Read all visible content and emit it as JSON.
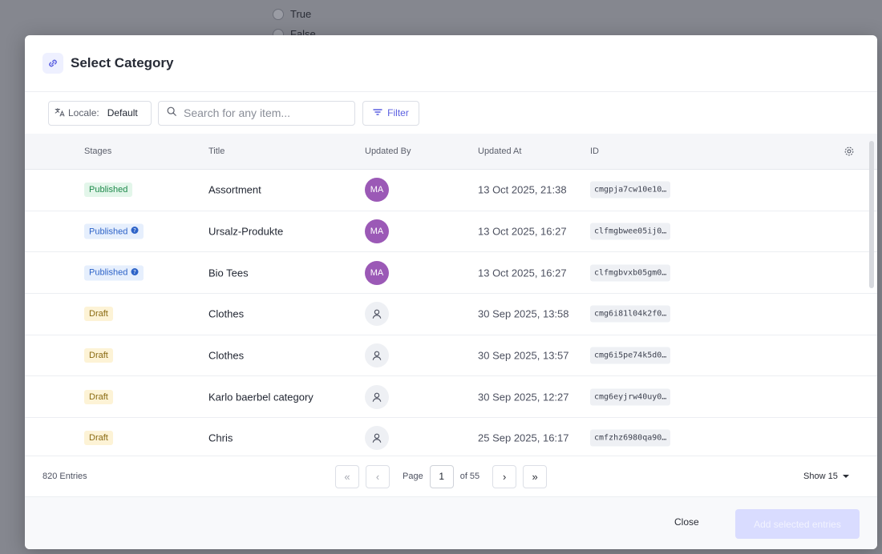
{
  "background": {
    "radios": [
      {
        "label": "True"
      },
      {
        "label": "False"
      }
    ]
  },
  "modal": {
    "title": "Select Category",
    "locale": {
      "label": "Locale:",
      "value": "Default"
    },
    "search": {
      "placeholder": "Search for any item..."
    },
    "filter_label": "Filter"
  },
  "table": {
    "headers": {
      "stages": "Stages",
      "title": "Title",
      "updated_by": "Updated By",
      "updated_at": "Updated At",
      "id": "ID"
    },
    "rows": [
      {
        "stage": "Published",
        "stage_type": "published",
        "title": "Assortment",
        "user": "MA",
        "updated_at": "13 Oct 2025, 21:38",
        "id": "cmgpja7cw10e10…"
      },
      {
        "stage": "Published",
        "stage_type": "published-info",
        "title": "Ursalz-Produkte",
        "user": "MA",
        "updated_at": "13 Oct 2025, 16:27",
        "id": "clfmgbwee05ij0…"
      },
      {
        "stage": "Published",
        "stage_type": "published-info",
        "title": "Bio Tees",
        "user": "MA",
        "updated_at": "13 Oct 2025, 16:27",
        "id": "clfmgbvxb05gm0…"
      },
      {
        "stage": "Draft",
        "stage_type": "draft",
        "title": "Clothes",
        "user": "",
        "updated_at": "30 Sep 2025, 13:58",
        "id": "cmg6i81l04k2f0…"
      },
      {
        "stage": "Draft",
        "stage_type": "draft",
        "title": "Clothes",
        "user": "",
        "updated_at": "30 Sep 2025, 13:57",
        "id": "cmg6i5pe74k5d0…"
      },
      {
        "stage": "Draft",
        "stage_type": "draft",
        "title": "Karlo baerbel category",
        "user": "",
        "updated_at": "30 Sep 2025, 12:27",
        "id": "cmg6eyjrw40uy0…"
      },
      {
        "stage": "Draft",
        "stage_type": "draft",
        "title": "Chris",
        "user": "",
        "updated_at": "25 Sep 2025, 16:17",
        "id": "cmfzhz6980qa90…"
      }
    ]
  },
  "footer": {
    "entries": "820 Entries",
    "page_label": "Page",
    "page_value": "1",
    "of_pages": "of 55",
    "show": "Show 15"
  },
  "actions": {
    "close": "Close",
    "add": "Add selected entries"
  },
  "colors": {
    "accent": "#5a5fe0",
    "avatar": "#9b59b6",
    "published": "#1f8a4c",
    "draft": "#8a6a12"
  }
}
